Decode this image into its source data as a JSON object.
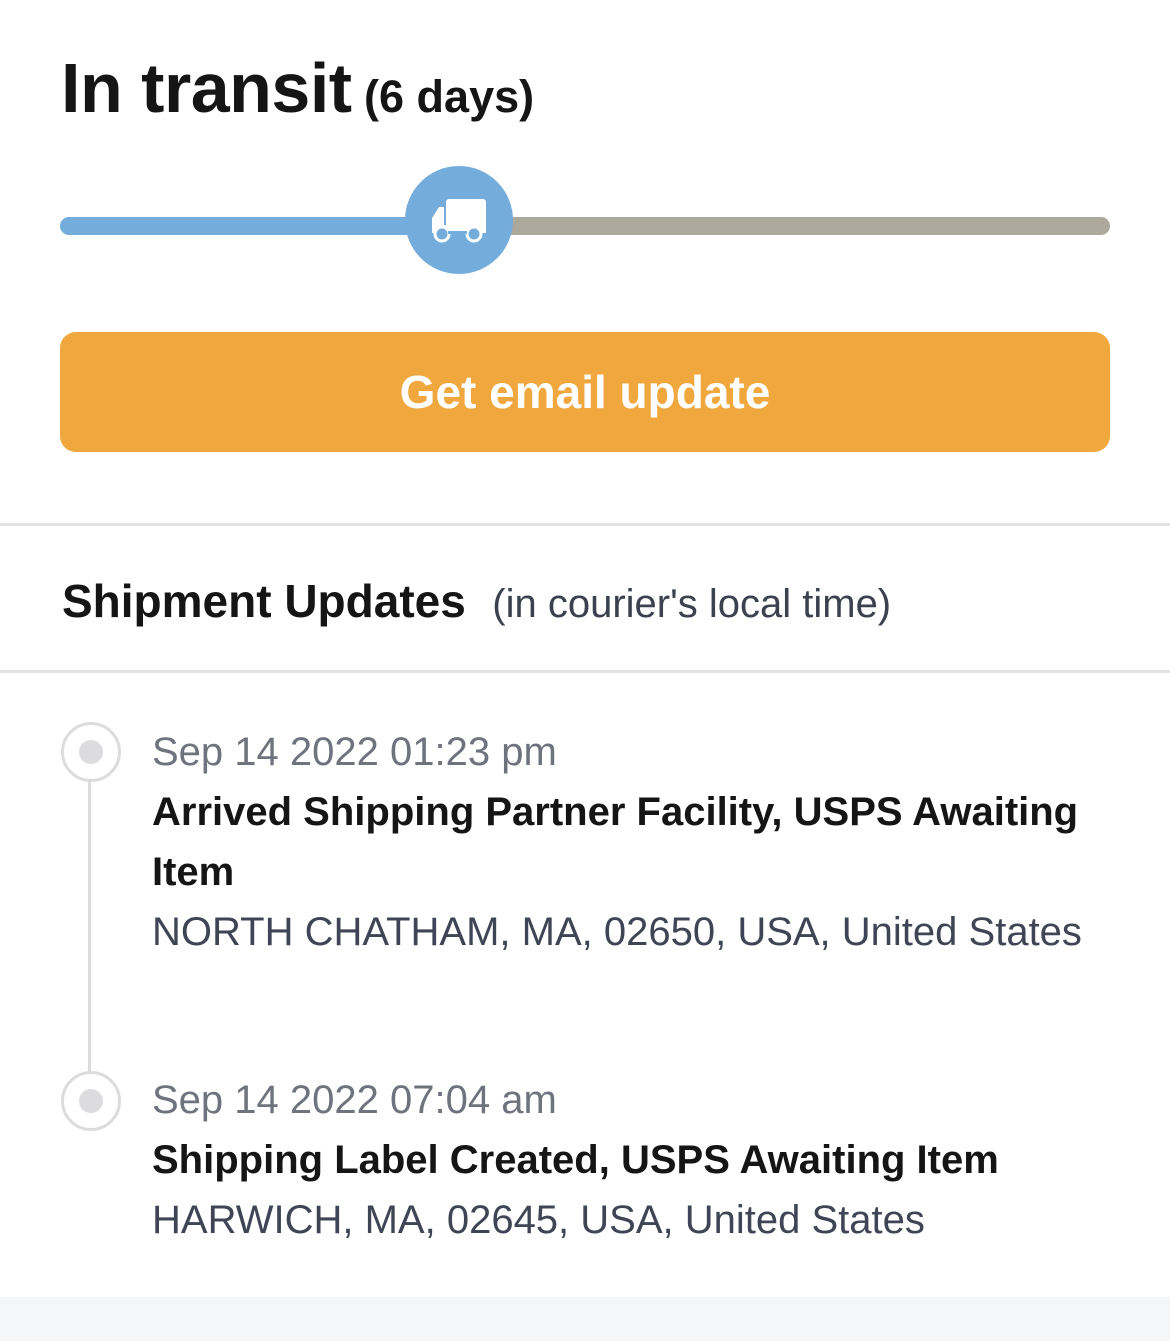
{
  "status": {
    "title": "In transit",
    "duration": "(6 days)",
    "progress_fraction": 0.38,
    "colors": {
      "done": "#74acdc",
      "remaining": "#aca89c"
    },
    "indicator_icon": "truck-icon"
  },
  "email_button": {
    "label": "Get email update",
    "color": "#f0a83e"
  },
  "updates": {
    "title": "Shipment Updates",
    "subtitle": "(in courier's local time)",
    "events": [
      {
        "time": "Sep 14 2022 01:23 pm",
        "status": "Arrived Shipping Partner Facility, USPS Awaiting Item",
        "location": "NORTH CHATHAM, MA, 02650, USA, United States"
      },
      {
        "time": "Sep 14 2022 07:04 am",
        "status": "Shipping Label Created, USPS Awaiting Item",
        "location": "HARWICH, MA, 02645, USA, United States"
      }
    ]
  }
}
